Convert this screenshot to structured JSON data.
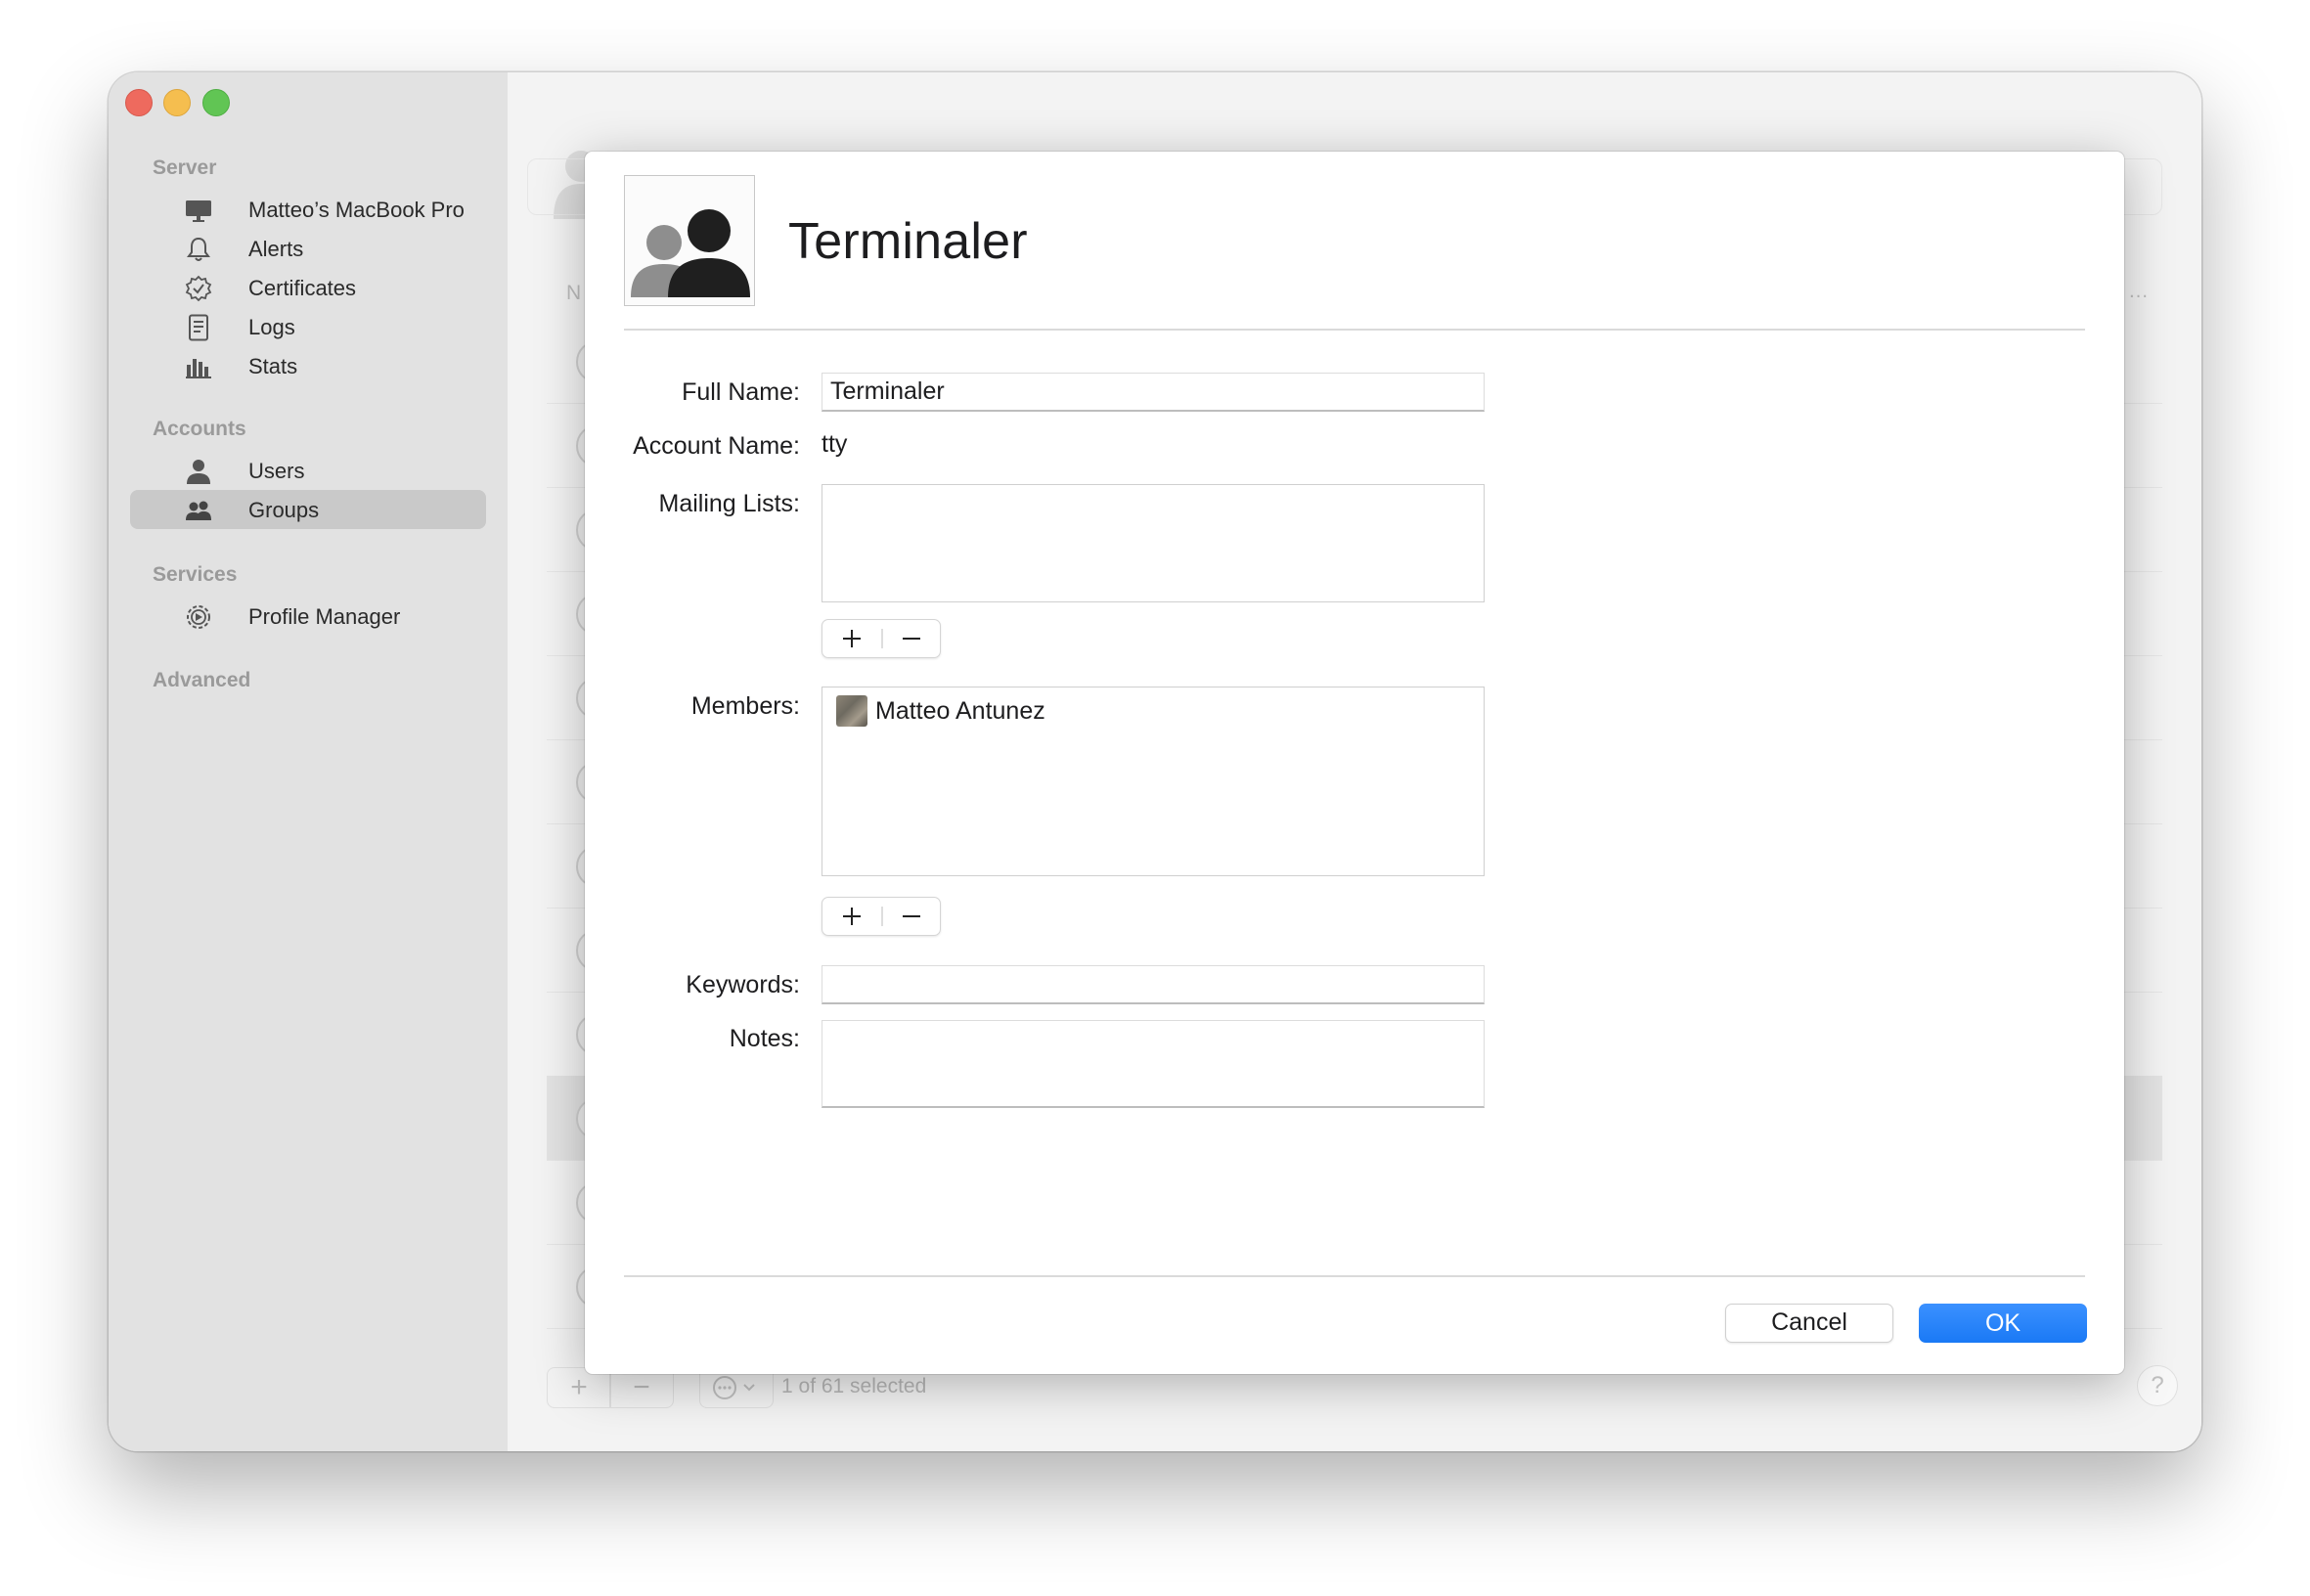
{
  "sidebar": {
    "sections": [
      {
        "title": "Server"
      },
      {
        "title": "Accounts"
      },
      {
        "title": "Services"
      },
      {
        "title": "Advanced"
      }
    ],
    "items": [
      {
        "label": "Matteo’s MacBook Pro",
        "icon": "display-icon"
      },
      {
        "label": "Alerts",
        "icon": "bell-icon"
      },
      {
        "label": "Certificates",
        "icon": "certificate-icon"
      },
      {
        "label": "Logs",
        "icon": "document-icon"
      },
      {
        "label": "Stats",
        "icon": "bar-chart-icon"
      },
      {
        "label": "Users",
        "icon": "user-icon"
      },
      {
        "label": "Groups",
        "icon": "group-icon",
        "selected": true
      },
      {
        "label": "Profile Manager",
        "icon": "gear-icon"
      }
    ]
  },
  "background": {
    "column_header_fragment": "N",
    "status": "1 of 61 selected"
  },
  "sheet": {
    "group_name": "Terminaler",
    "labels": {
      "full_name": "Full Name:",
      "account_name": "Account Name:",
      "mailing_lists": "Mailing Lists:",
      "members": "Members:",
      "keywords": "Keywords:",
      "notes": "Notes:"
    },
    "values": {
      "full_name": "Terminaler",
      "account_name": "tty",
      "keywords": "",
      "notes": ""
    },
    "members": [
      {
        "name": "Matteo Antunez"
      }
    ],
    "buttons": {
      "cancel": "Cancel",
      "ok": "OK"
    }
  },
  "colors": {
    "accent": "#1a79f5",
    "close": "#ee6a5e",
    "minimize": "#f5be4f",
    "maximize": "#61c554"
  }
}
